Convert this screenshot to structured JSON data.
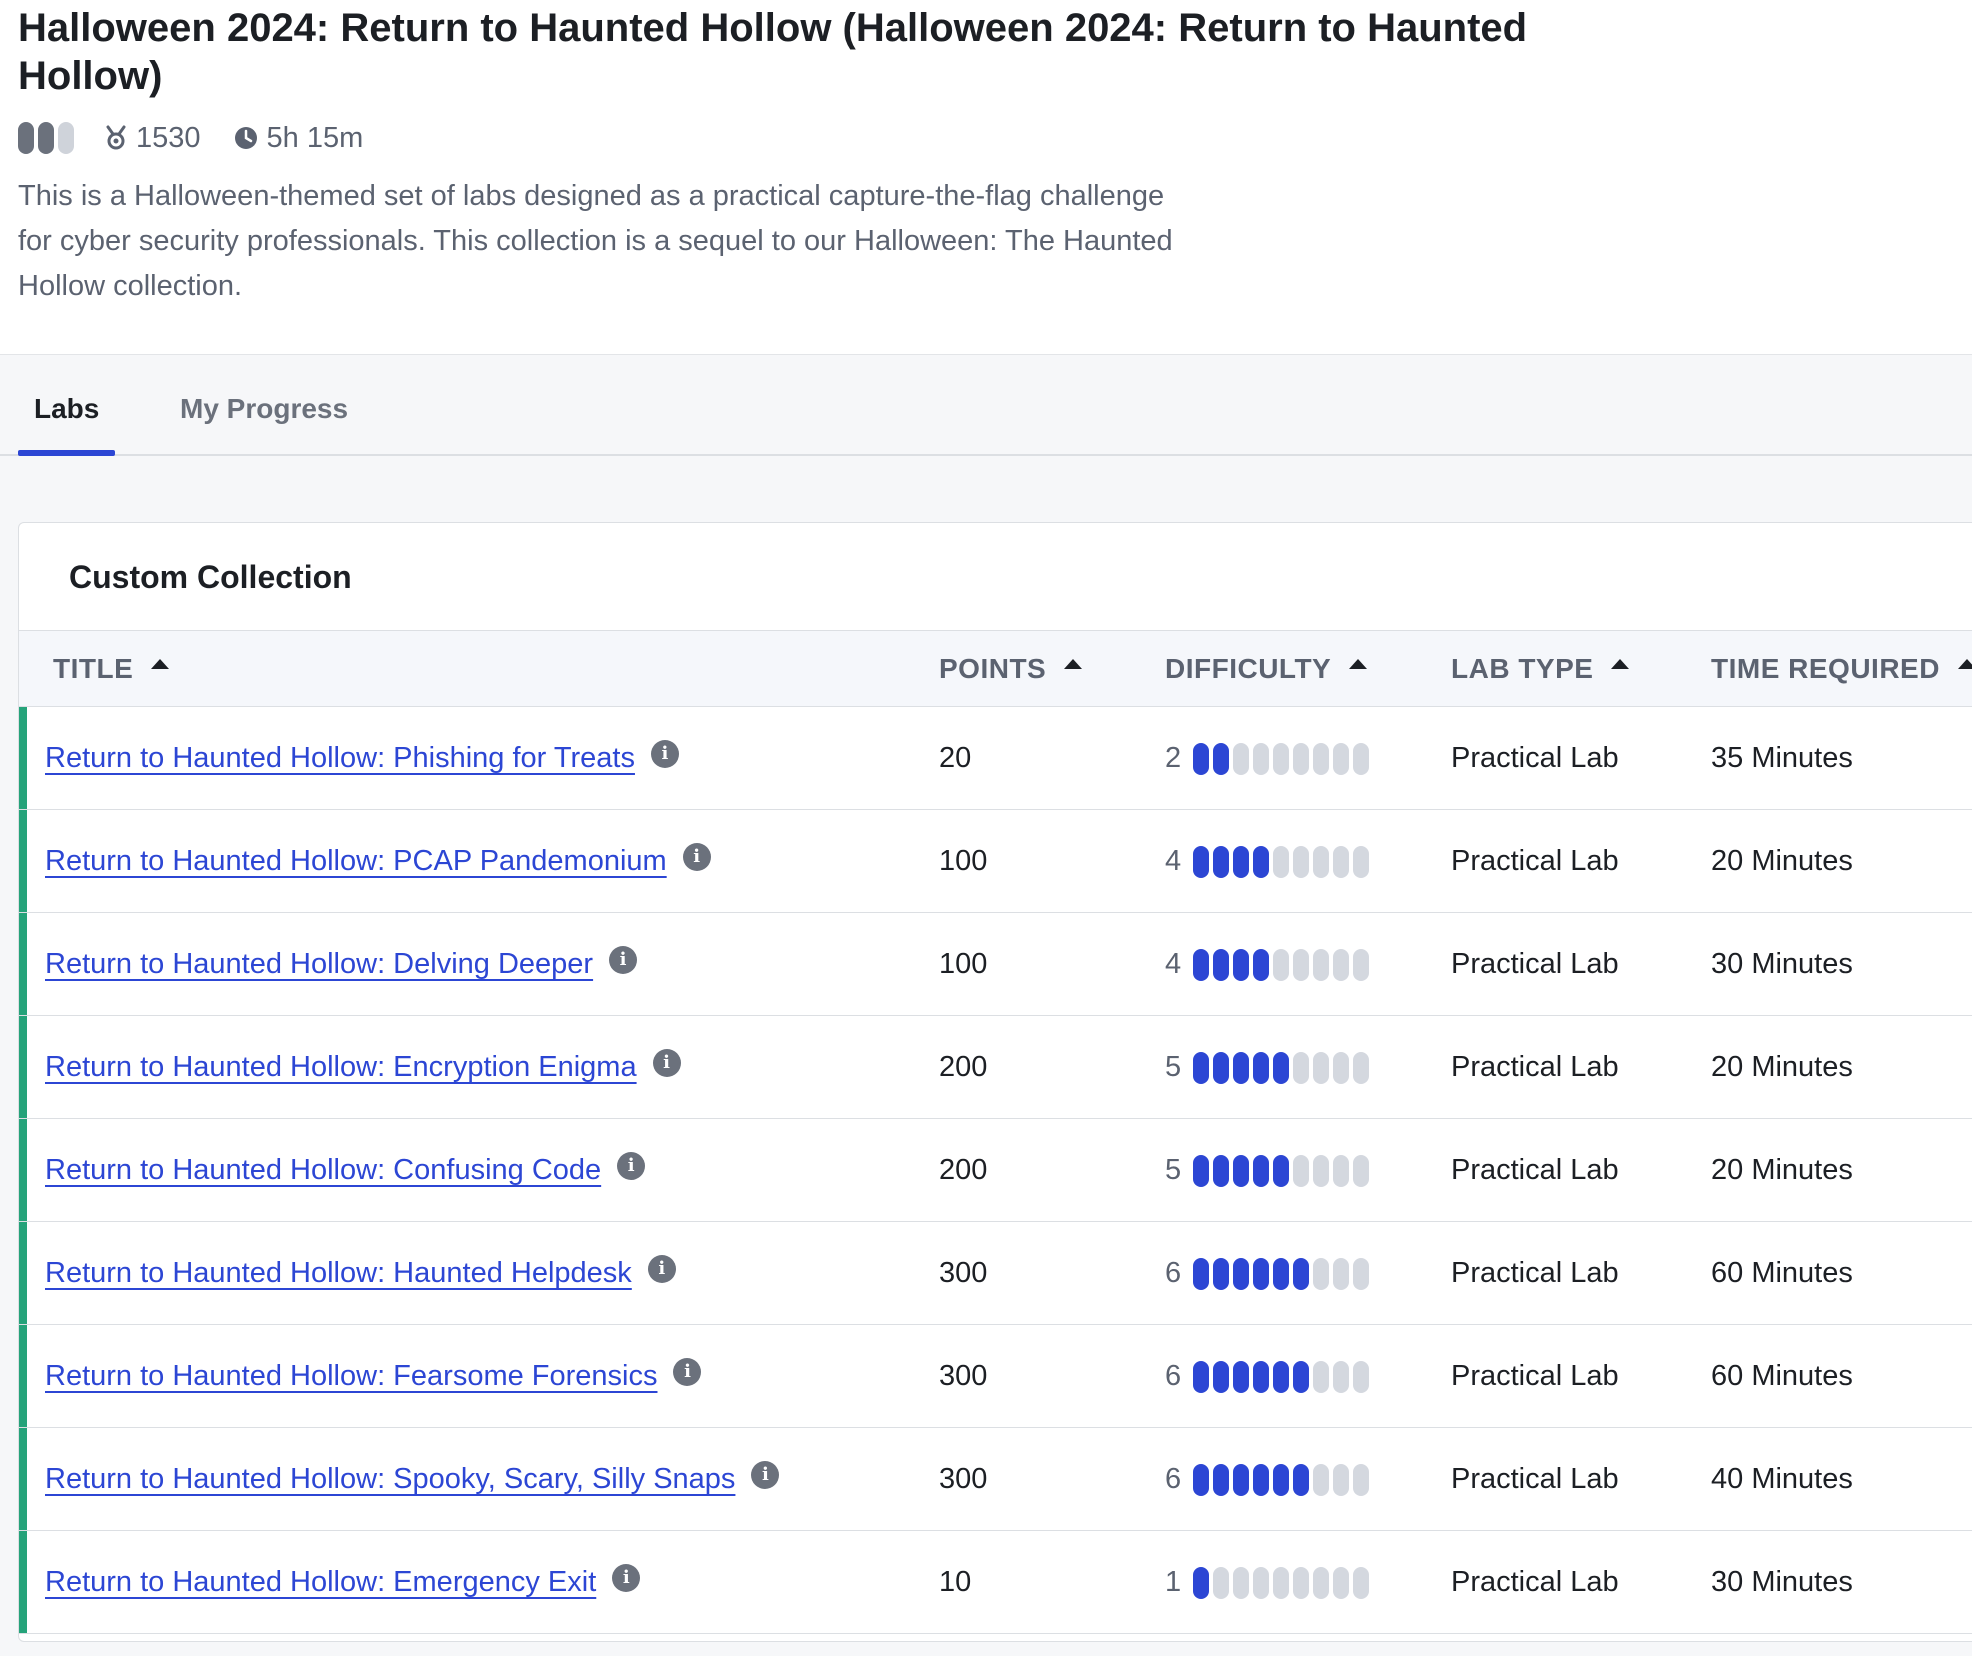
{
  "page": {
    "title": "Halloween 2024: Return to Haunted Hollow (Halloween 2024: Return to Haunted Hollow)",
    "difficulty_level": 2,
    "difficulty_max": 3,
    "points": "1530",
    "duration": "5h 15m",
    "description": "This is a Halloween-themed set of labs designed as a practical capture-the-flag challenge for cyber security professionals. This collection is a sequel to our Halloween: The Haunted Hollow collection.",
    "icons": {
      "points": "medal-icon",
      "duration": "clock-icon",
      "info": "info-icon"
    }
  },
  "tabs": [
    {
      "label": "Labs",
      "active": true
    },
    {
      "label": "My Progress",
      "active": false
    }
  ],
  "collection": {
    "title": "Custom Collection",
    "headers": {
      "title": "TITLE",
      "points": "POINTS",
      "difficulty": "DIFFICULTY",
      "lab_type": "LAB TYPE",
      "time": "TIME REQUIRED"
    },
    "difficulty_scale_max": 9,
    "colors": {
      "accent": "#2c46d4",
      "completed_bar": "#25a37a"
    },
    "rows": [
      {
        "title": "Return to Haunted Hollow: Phishing for Treats",
        "points": "20",
        "difficulty": "2",
        "level": 2,
        "lab_type": "Practical Lab",
        "time": "35 Minutes"
      },
      {
        "title": "Return to Haunted Hollow: PCAP Pandemonium",
        "points": "100",
        "difficulty": "4",
        "level": 4,
        "lab_type": "Practical Lab",
        "time": "20 Minutes"
      },
      {
        "title": "Return to Haunted Hollow: Delving Deeper",
        "points": "100",
        "difficulty": "4",
        "level": 4,
        "lab_type": "Practical Lab",
        "time": "30 Minutes"
      },
      {
        "title": "Return to Haunted Hollow: Encryption Enigma",
        "points": "200",
        "difficulty": "5",
        "level": 5,
        "lab_type": "Practical Lab",
        "time": "20 Minutes"
      },
      {
        "title": "Return to Haunted Hollow: Confusing Code",
        "points": "200",
        "difficulty": "5",
        "level": 5,
        "lab_type": "Practical Lab",
        "time": "20 Minutes"
      },
      {
        "title": "Return to Haunted Hollow: Haunted Helpdesk",
        "points": "300",
        "difficulty": "6",
        "level": 6,
        "lab_type": "Practical Lab",
        "time": "60 Minutes"
      },
      {
        "title": "Return to Haunted Hollow: Fearsome Forensics",
        "points": "300",
        "difficulty": "6",
        "level": 6,
        "lab_type": "Practical Lab",
        "time": "60 Minutes"
      },
      {
        "title": "Return to Haunted Hollow: Spooky, Scary, Silly Snaps",
        "points": "300",
        "difficulty": "6",
        "level": 6,
        "lab_type": "Practical Lab",
        "time": "40 Minutes"
      },
      {
        "title": "Return to Haunted Hollow: Emergency Exit",
        "points": "10",
        "difficulty": "1",
        "level": 1,
        "lab_type": "Practical Lab",
        "time": "30 Minutes"
      }
    ]
  }
}
